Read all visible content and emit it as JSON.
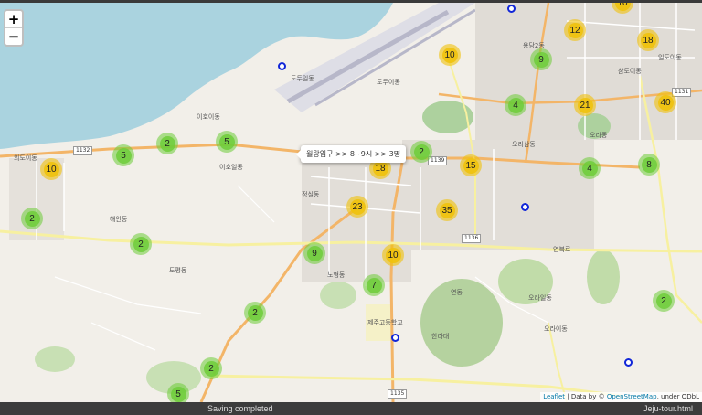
{
  "zoom": {
    "in_label": "+",
    "out_label": "−"
  },
  "popup": {
    "text": "월랑입구 >> 8~9시 >> 3명"
  },
  "clusters": [
    {
      "label": "10",
      "size": "medium"
    },
    {
      "label": "12",
      "size": "medium"
    },
    {
      "label": "18",
      "size": "medium"
    },
    {
      "label": "9",
      "size": "small"
    },
    {
      "label": "10",
      "size": "medium"
    },
    {
      "label": "4",
      "size": "small"
    },
    {
      "label": "21",
      "size": "medium"
    },
    {
      "label": "40",
      "size": "medium"
    },
    {
      "label": "5",
      "size": "small"
    },
    {
      "label": "5",
      "size": "small"
    },
    {
      "label": "2",
      "size": "small"
    },
    {
      "label": "10",
      "size": "medium"
    },
    {
      "label": "2",
      "size": "small"
    },
    {
      "label": "18",
      "size": "medium"
    },
    {
      "label": "15",
      "size": "medium"
    },
    {
      "label": "4",
      "size": "small"
    },
    {
      "label": "8",
      "size": "small"
    },
    {
      "label": "2",
      "size": "small"
    },
    {
      "label": "23",
      "size": "medium"
    },
    {
      "label": "35",
      "size": "medium"
    },
    {
      "label": "2",
      "size": "small"
    },
    {
      "label": "9",
      "size": "small"
    },
    {
      "label": "10",
      "size": "medium"
    },
    {
      "label": "7",
      "size": "small"
    },
    {
      "label": "2",
      "size": "small"
    },
    {
      "label": "2",
      "size": "small"
    },
    {
      "label": "2",
      "size": "small"
    },
    {
      "label": "5",
      "size": "small"
    }
  ],
  "place_labels": [
    "도두일동",
    "도두이동",
    "이호이동",
    "이호일동",
    "외도이동",
    "오라삼동",
    "오라이동",
    "도평동",
    "연동",
    "노형동",
    "용담2동",
    "삼도이동",
    "일도이동",
    "오라동",
    "오라일동",
    "해안동",
    "연북로",
    "정실동",
    "한라대",
    "제주고등학교"
  ],
  "road_labels": [
    "1132",
    "1139",
    "1136",
    "1131",
    "1135"
  ],
  "attribution": {
    "leaflet": "Leaflet",
    "sep": " | Data by © ",
    "osm": "OpenStreetMap",
    "tail": ", under ODbL"
  },
  "status": {
    "message": "Saving completed",
    "file": "Jeju-tour.html"
  }
}
